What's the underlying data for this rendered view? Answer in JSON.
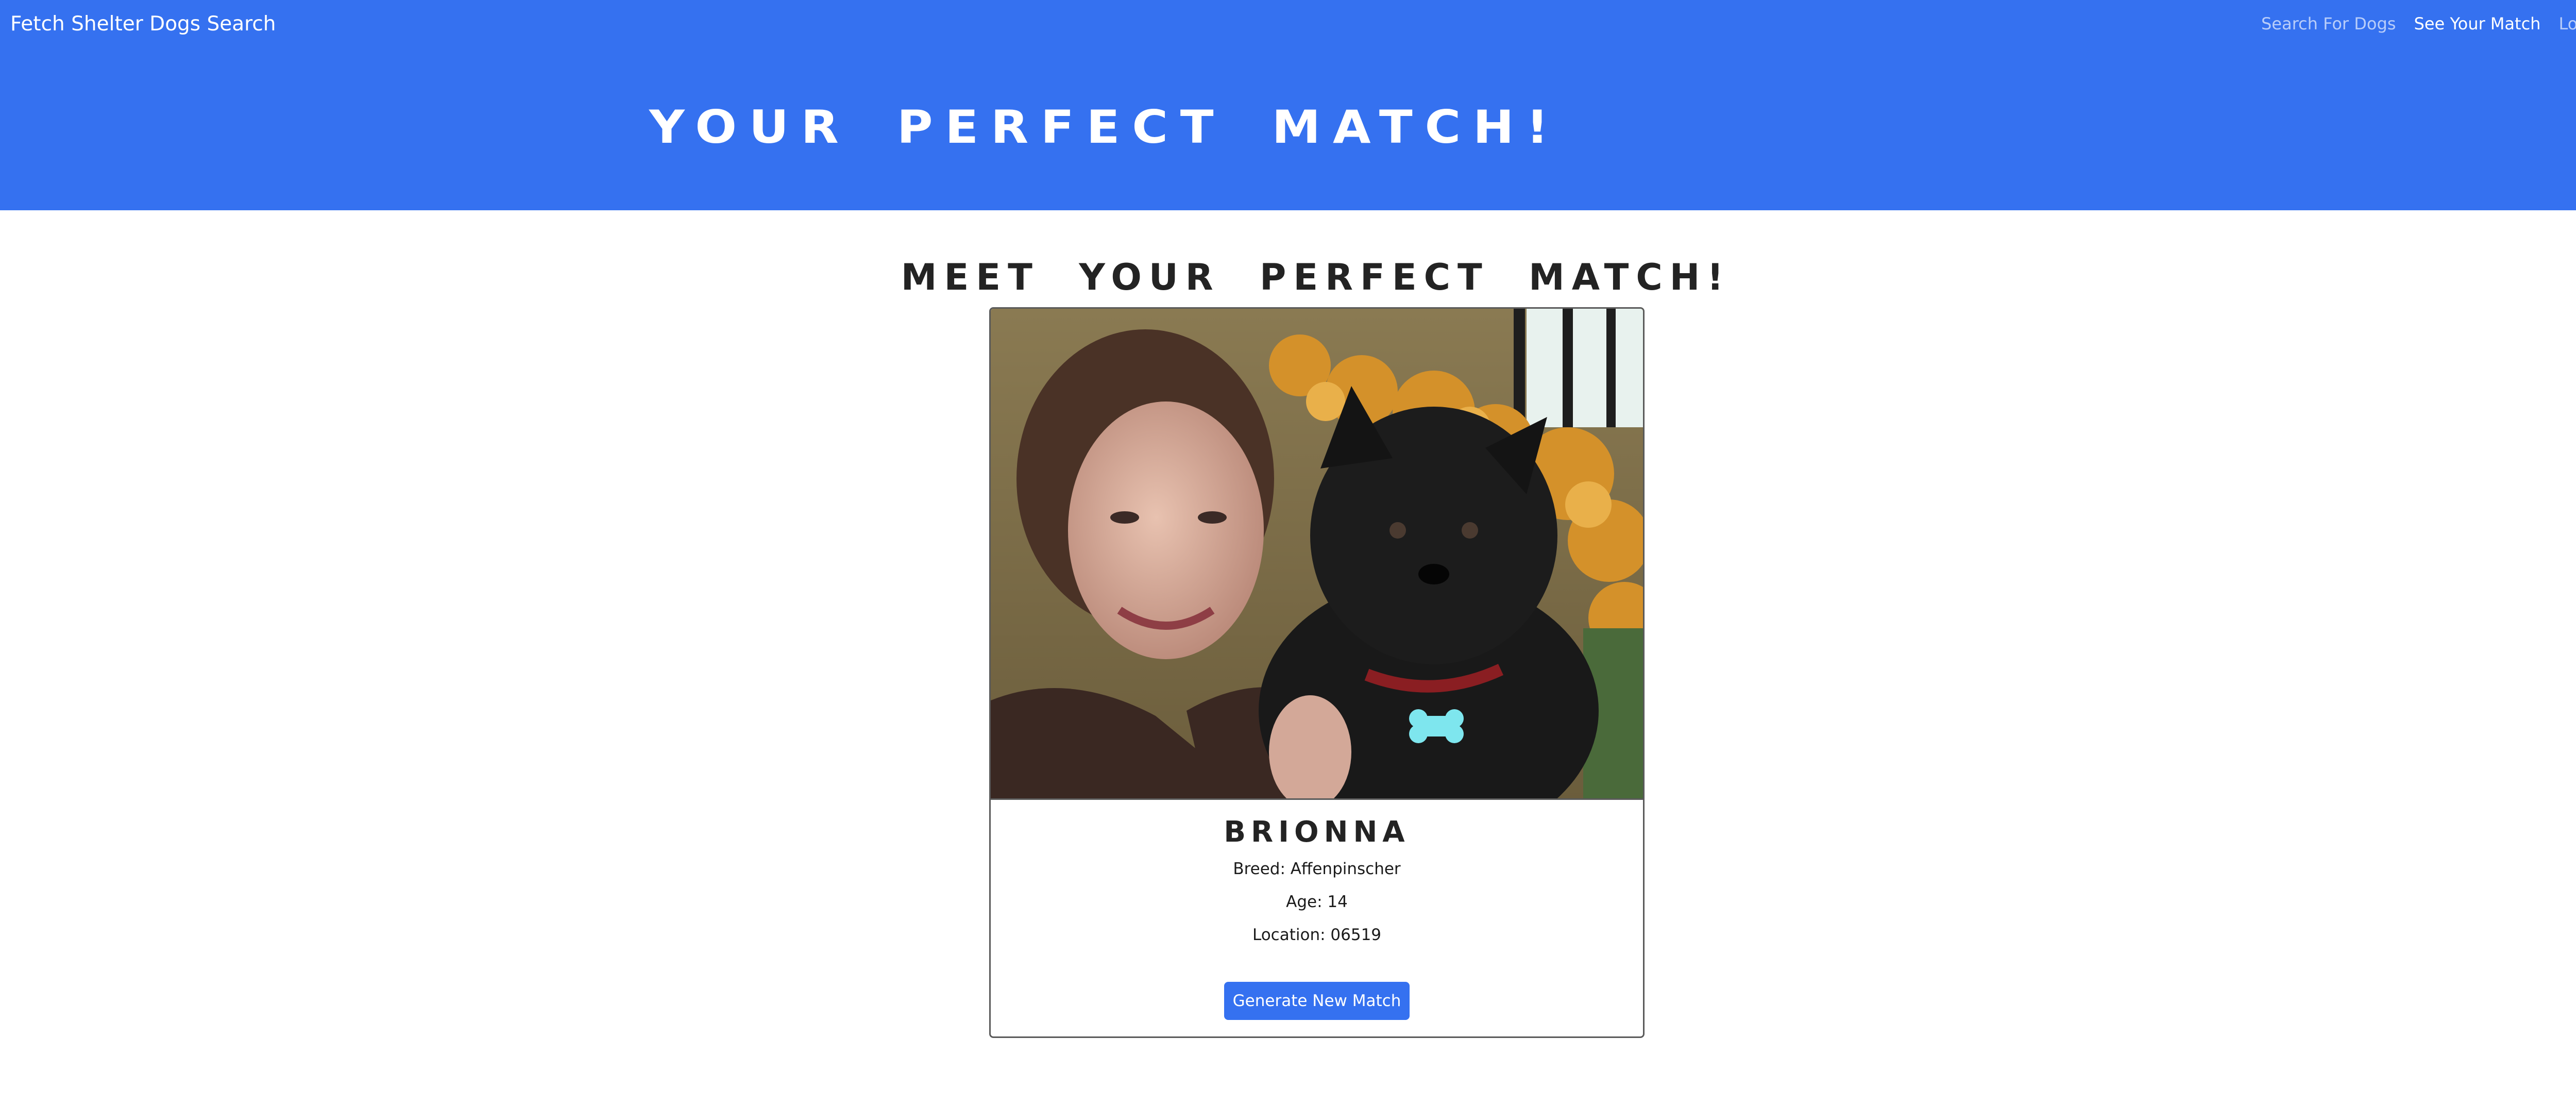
{
  "navbar": {
    "brand": "Fetch Shelter Dogs Search",
    "links": [
      {
        "label": "Search For Dogs",
        "active": false
      },
      {
        "label": "See Your Match",
        "active": true
      },
      {
        "label": "Logout",
        "active": false
      }
    ]
  },
  "hero": {
    "title": "YOUR PERFECT MATCH!"
  },
  "main": {
    "section_title": "MEET YOUR PERFECT MATCH!",
    "match": {
      "name": "BRIONNA",
      "breed": "Breed: Affenpinscher",
      "age": "Age: 14",
      "location": "Location: 06519"
    },
    "generate_button": "Generate New Match"
  },
  "colors": {
    "primary": "#3571f0",
    "text_dark": "#232323"
  }
}
